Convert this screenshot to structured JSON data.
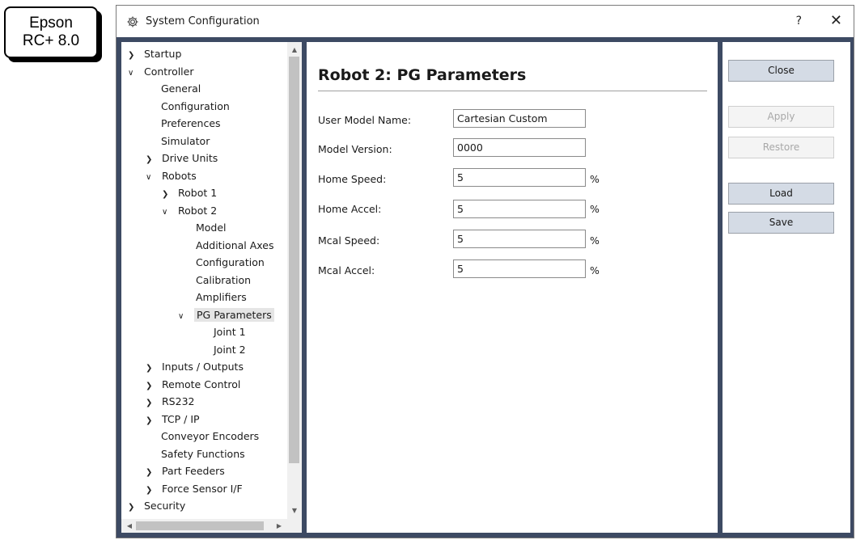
{
  "badge": {
    "line1": "Epson",
    "line2": "RC+ 8.0"
  },
  "window": {
    "title": "System Configuration",
    "help_label": "?",
    "close_label": "✕",
    "title_icon": "gear-icon"
  },
  "tree": {
    "items": [
      {
        "label": "Startup",
        "arrow": "›",
        "expanded": false
      },
      {
        "label": "Controller",
        "arrow": "⌄",
        "expanded": true
      },
      {
        "label": "General"
      },
      {
        "label": "Configuration"
      },
      {
        "label": "Preferences"
      },
      {
        "label": "Simulator"
      },
      {
        "label": "Drive Units",
        "arrow": "›"
      },
      {
        "label": "Robots",
        "arrow": "⌄"
      },
      {
        "label": "Robot 1",
        "arrow": "›"
      },
      {
        "label": "Robot 2",
        "arrow": "⌄"
      },
      {
        "label": "Model"
      },
      {
        "label": "Additional Axes"
      },
      {
        "label": "Configuration"
      },
      {
        "label": "Calibration"
      },
      {
        "label": "Amplifiers"
      },
      {
        "label": "PG Parameters",
        "arrow": "⌄",
        "selected": true
      },
      {
        "label": "Joint 1"
      },
      {
        "label": "Joint 2"
      },
      {
        "label": "Inputs / Outputs",
        "arrow": "›"
      },
      {
        "label": "Remote Control",
        "arrow": "›"
      },
      {
        "label": "RS232",
        "arrow": "›"
      },
      {
        "label": "TCP / IP",
        "arrow": "›"
      },
      {
        "label": "Conveyor Encoders"
      },
      {
        "label": "Safety Functions"
      },
      {
        "label": "Part Feeders",
        "arrow": "›"
      },
      {
        "label": "Force Sensor I/F",
        "arrow": "›"
      },
      {
        "label": "Security",
        "arrow": "›"
      }
    ]
  },
  "content": {
    "title": "Robot 2: PG Parameters",
    "fields": [
      {
        "label": "User Model Name:",
        "value": "Cartesian Custom",
        "unit": ""
      },
      {
        "label": "Model Version:",
        "value": "0000",
        "unit": ""
      },
      {
        "label": "Home Speed:",
        "value": "5",
        "unit": "%"
      },
      {
        "label": "Home Accel:",
        "value": "5",
        "unit": "%"
      },
      {
        "label": "Mcal Speed:",
        "value": "5",
        "unit": "%"
      },
      {
        "label": "Mcal Accel:",
        "value": "5",
        "unit": "%"
      }
    ]
  },
  "buttons": {
    "close": "Close",
    "apply": "Apply",
    "restore": "Restore",
    "load": "Load",
    "save": "Save"
  },
  "colors": {
    "window_frame": "#3d4a63",
    "button_face": "#d4dbe5",
    "selected_item": "#e5e5e5"
  }
}
